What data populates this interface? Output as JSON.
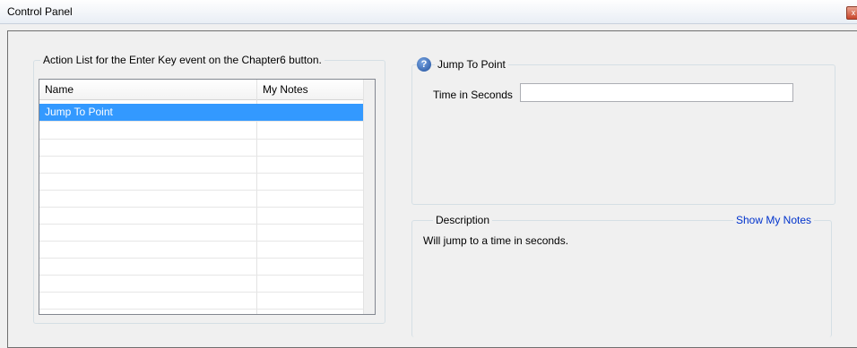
{
  "window": {
    "title": "Control Panel",
    "close_glyph": "x"
  },
  "action_list": {
    "legend": "Action List for the Enter Key event on the Chapter6 button.",
    "columns": [
      "Name",
      "My Notes"
    ],
    "rows": [
      {
        "name": "Jump To Point",
        "notes": "",
        "selected": true
      }
    ]
  },
  "action_panel": {
    "legend": "Jump To Point",
    "field_label": "Time in Seconds",
    "field_value": "",
    "help_icon": "help-icon"
  },
  "description_panel": {
    "legend": "Description",
    "text": "Will jump to a time in seconds.",
    "show_notes_label": "Show My Notes"
  },
  "colors": {
    "selection": "#3399ff",
    "link": "#0033cc"
  }
}
